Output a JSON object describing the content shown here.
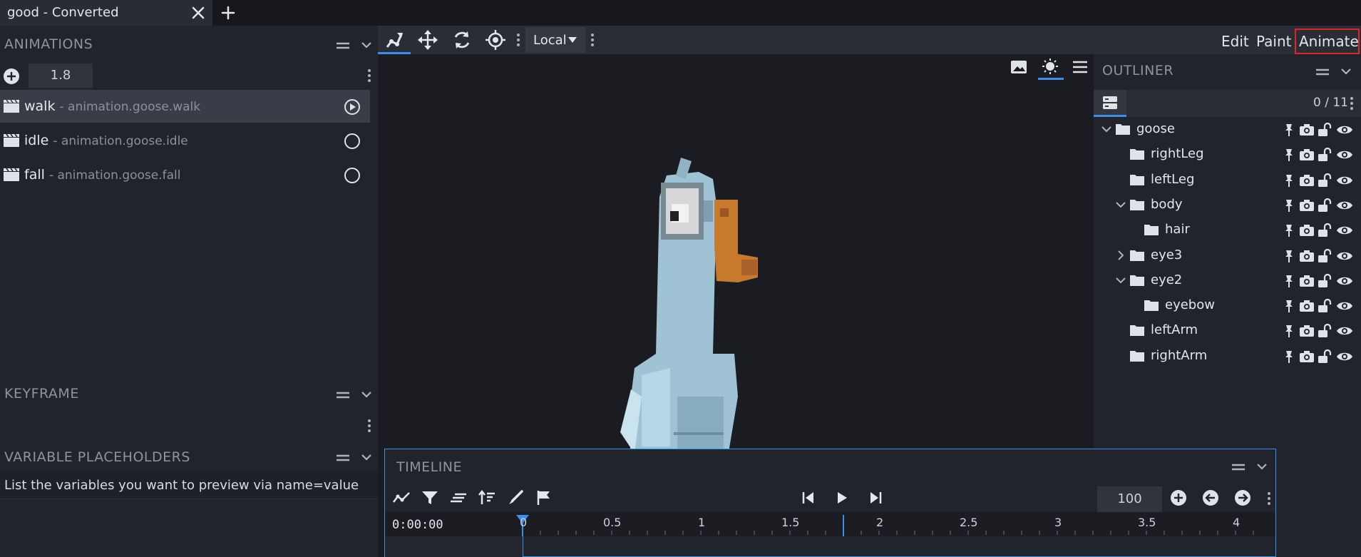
{
  "tab": {
    "title": "good - Converted",
    "close_icon": "close-icon",
    "new_icon": "plus-icon"
  },
  "animations": {
    "title": "ANIMATIONS",
    "value": "1.8",
    "items": [
      {
        "name": "walk",
        "id": "- animation.goose.walk",
        "selected": true,
        "playing": true
      },
      {
        "name": "idle",
        "id": "- animation.goose.idle",
        "selected": false,
        "playing": false
      },
      {
        "name": "fall",
        "id": "- animation.goose.fall",
        "selected": false,
        "playing": false
      }
    ]
  },
  "keyframe": {
    "title": "KEYFRAME"
  },
  "variables": {
    "title": "VARIABLE PLACEHOLDERS",
    "hint": "List the variables you want to preview via name=value"
  },
  "toolbar": {
    "tools": [
      "pose-tool-icon",
      "move-tool-icon",
      "rotate-tool-icon",
      "pivot-tool-icon"
    ],
    "space": "Local",
    "modes": {
      "edit": "Edit",
      "paint": "Paint",
      "animate": "Animate"
    },
    "active_mode": "Animate"
  },
  "outliner": {
    "title": "OUTLINER",
    "count": "0 / 11",
    "nodes": [
      {
        "label": "goose",
        "depth": 0,
        "caret": "down"
      },
      {
        "label": "rightLeg",
        "depth": 1,
        "caret": ""
      },
      {
        "label": "leftLeg",
        "depth": 1,
        "caret": ""
      },
      {
        "label": "body",
        "depth": 1,
        "caret": "down"
      },
      {
        "label": "hair",
        "depth": 2,
        "caret": ""
      },
      {
        "label": "eye3",
        "depth": 1,
        "caret": "right"
      },
      {
        "label": "eye2",
        "depth": 1,
        "caret": "down"
      },
      {
        "label": "eyebow",
        "depth": 2,
        "caret": ""
      },
      {
        "label": "leftArm",
        "depth": 1,
        "caret": ""
      },
      {
        "label": "rightArm",
        "depth": 1,
        "caret": ""
      }
    ]
  },
  "timeline": {
    "title": "TIMELINE",
    "time": "0:00:00",
    "zoom": "100",
    "tick_labels": [
      "0",
      "0.5",
      "1",
      "1.5",
      "2",
      "2.5",
      "3",
      "3.5",
      "4"
    ],
    "animation_end": 1.8
  },
  "colors": {
    "accent": "#3b8eea",
    "highlight": "#e0242a"
  }
}
